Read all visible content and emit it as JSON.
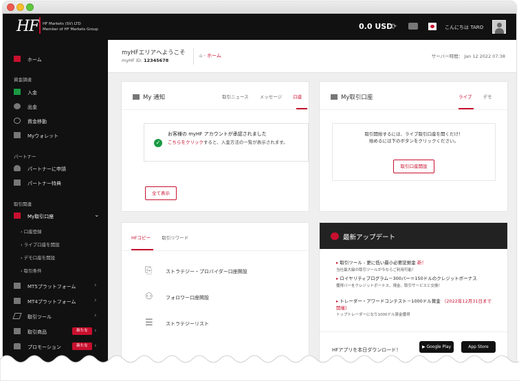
{
  "app": {
    "logo_text": "HF",
    "company_line1": "HF Markets (SV) LTD",
    "company_line2": "Member of HF Markets Group",
    "balance": "0.0 USD",
    "greeting": "こんにちは TARO"
  },
  "sidebar": {
    "home": "ホーム",
    "section_funds": "資金調達",
    "deposit": "入金",
    "withdraw": "出金",
    "transfer": "資金移動",
    "wallet": "Myウォレット",
    "section_partner": "パートナー",
    "partner_apply": "パートナーに申請",
    "partner_benefits": "パートナー特典",
    "section_trading": "取引関連",
    "my_accounts": "My取引口座",
    "sub_accounts": [
      "口座登録",
      "ライブ口座を開設",
      "デモ口座を開設",
      "取引条件"
    ],
    "mt5": "MT5プラットフォーム",
    "mt4": "MT4プラットフォーム",
    "tools": "取引ツール",
    "products": "取引商品",
    "promotions": "プロモーション",
    "badge_new": "新たな"
  },
  "header": {
    "welcome": "myHFエリアへようこそ",
    "id_label": "myHF ID:",
    "id_value": "12345678",
    "breadcrumb": "ホーム",
    "server_time": "サーバー時間： Jan 12 2022 07:38"
  },
  "notifications": {
    "title": "My 通知",
    "tabs": [
      "取引ニュース",
      "メッセージ",
      "口座"
    ],
    "notice_title": "お客様の myHF アカウントが承認されました",
    "notice_link": "こちらをクリック",
    "notice_text": "すると、入金方法の一覧が表示されます。",
    "show_all": "全て表示"
  },
  "accounts": {
    "title": "My取引口座",
    "tabs": [
      "ライブ",
      "デモ"
    ],
    "message_line1": "取引開始するには、ライブ取引口座を開くだけ！",
    "message_line2": "始めるには下のボタンをクリックください。",
    "open_button": "取引口座開設"
  },
  "copy": {
    "tabs": [
      "HFコピー",
      "取引リワード"
    ],
    "items": [
      "ストラテジー・プロバイダー口座開設",
      "フォロワー口座開設",
      "ストラテジーリスト"
    ]
  },
  "news": {
    "title": "最新アップデート",
    "item1_title": "取引ツール - 更に低い最小必要証拠金",
    "item1_new": "新！",
    "item1_sub": "当社最大級の取引ツールが今ならご利用可能！",
    "item2_title": "ロイヤリティプログラム－300バー＝150ドルのクレジットボーナス",
    "item2_sub": "獲得バーをクレジットボーナス、現金、取引サービスと交換！",
    "item3_title": "トレーダー・アワードコンテスト－1000ドル賞金",
    "item3_date": "（2022年12月31日まで開催）",
    "item3_sub": "トップトレーダーになり1000ドル賞金獲得",
    "app_title": "HFアプリを本日ダウンロード！",
    "google_play": "Google Play",
    "app_store": "App Store"
  }
}
